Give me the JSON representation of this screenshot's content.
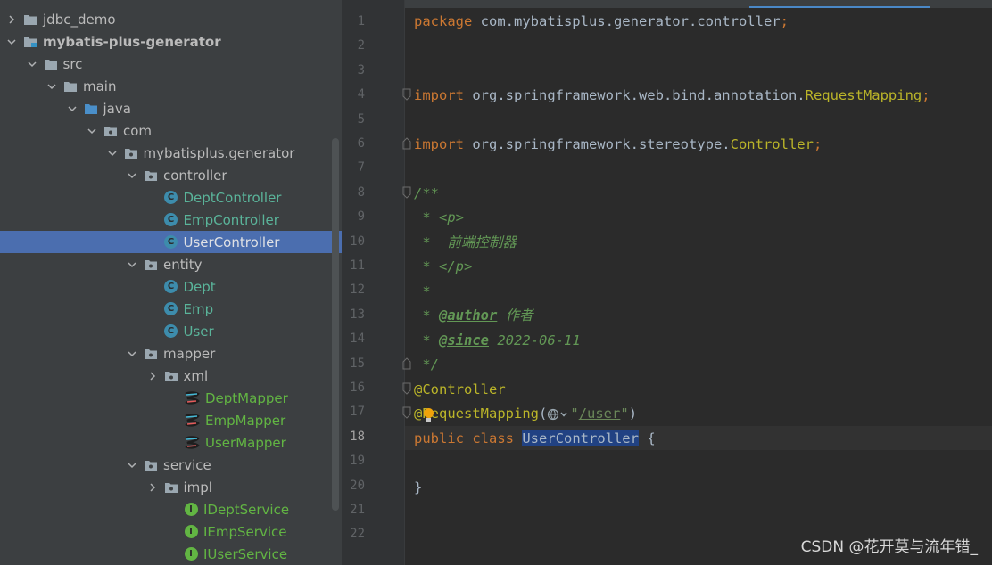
{
  "project_tree": {
    "rows": [
      {
        "label": "jdbc_demo",
        "expanded": false,
        "icon": "folder-icon"
      },
      {
        "label": "mybatis-plus-generator",
        "expanded": true,
        "icon": "module-icon"
      },
      {
        "label": "src",
        "expanded": true,
        "icon": "folder-icon"
      },
      {
        "label": "main",
        "expanded": true,
        "icon": "folder-icon"
      },
      {
        "label": "java",
        "expanded": true,
        "icon": "source-folder-icon"
      },
      {
        "label": "com",
        "expanded": true,
        "icon": "package-icon"
      },
      {
        "label": "mybatisplus.generator",
        "expanded": true,
        "icon": "package-icon"
      },
      {
        "label": "controller",
        "expanded": true,
        "icon": "package-icon"
      },
      {
        "label": "DeptController",
        "icon": "class-icon",
        "badge": "C"
      },
      {
        "label": "EmpController",
        "icon": "class-icon",
        "badge": "C"
      },
      {
        "label": "UserController",
        "icon": "class-icon",
        "badge": "C",
        "selected": true
      },
      {
        "label": "entity",
        "expanded": true,
        "icon": "package-icon"
      },
      {
        "label": "Dept",
        "icon": "class-icon",
        "badge": "C"
      },
      {
        "label": "Emp",
        "icon": "class-icon",
        "badge": "C"
      },
      {
        "label": "User",
        "icon": "class-icon",
        "badge": "C"
      },
      {
        "label": "mapper",
        "expanded": true,
        "icon": "package-icon"
      },
      {
        "label": "xml",
        "expanded": false,
        "icon": "package-icon"
      },
      {
        "label": "DeptMapper",
        "icon": "mapper-icon"
      },
      {
        "label": "EmpMapper",
        "icon": "mapper-icon"
      },
      {
        "label": "UserMapper",
        "icon": "mapper-icon"
      },
      {
        "label": "service",
        "expanded": true,
        "icon": "package-icon"
      },
      {
        "label": "impl",
        "expanded": false,
        "icon": "package-icon"
      },
      {
        "label": "IDeptService",
        "icon": "interface-icon",
        "badge": "I"
      },
      {
        "label": "IEmpService",
        "icon": "interface-icon",
        "badge": "I"
      },
      {
        "label": "IUserService",
        "icon": "interface-icon",
        "badge": "I"
      }
    ]
  },
  "editor": {
    "current_line": 18,
    "line_numbers": [
      "1",
      "2",
      "3",
      "4",
      "5",
      "6",
      "7",
      "8",
      "9",
      "10",
      "11",
      "12",
      "13",
      "14",
      "15",
      "16",
      "17",
      "18",
      "19",
      "20",
      "21",
      "22"
    ],
    "code": {
      "l1_kw": "package",
      "l1_rest": " com.mybatisplus.generator.controller",
      "l1_semi": ";",
      "l4_kw": "import",
      "l4_path": " org.springframework.web.bind.annotation.",
      "l4_cls": "RequestMapping",
      "l4_semi": ";",
      "l6_kw": "import",
      "l6_path": " org.springframework.stereotype.",
      "l6_cls": "Controller",
      "l6_semi": ";",
      "l8": "/**",
      "l9_pre": " * ",
      "l9_tag": "<p>",
      "l10": " *  前端控制器",
      "l11_pre": " * ",
      "l11_tag": "</p>",
      "l12": " *",
      "l13_pre": " * ",
      "l13_tag": "@author",
      "l13_val": " 作者",
      "l14_pre": " * ",
      "l14_tag": "@since",
      "l14_val": " 2022-06-11",
      "l15": " */",
      "l16": "@Controller",
      "l17_ann_a": "@",
      "l17_ann_b": "RequestMapping",
      "l17_open": "(",
      "l17_q1": "\"",
      "l17_path": "/user",
      "l17_q2": "\"",
      "l17_close": ")",
      "l18_kw": "public class ",
      "l18_cls": "UserController",
      "l18_brace": " {",
      "l20": "}"
    }
  },
  "watermark": "CSDN @花开莫与流年错_"
}
